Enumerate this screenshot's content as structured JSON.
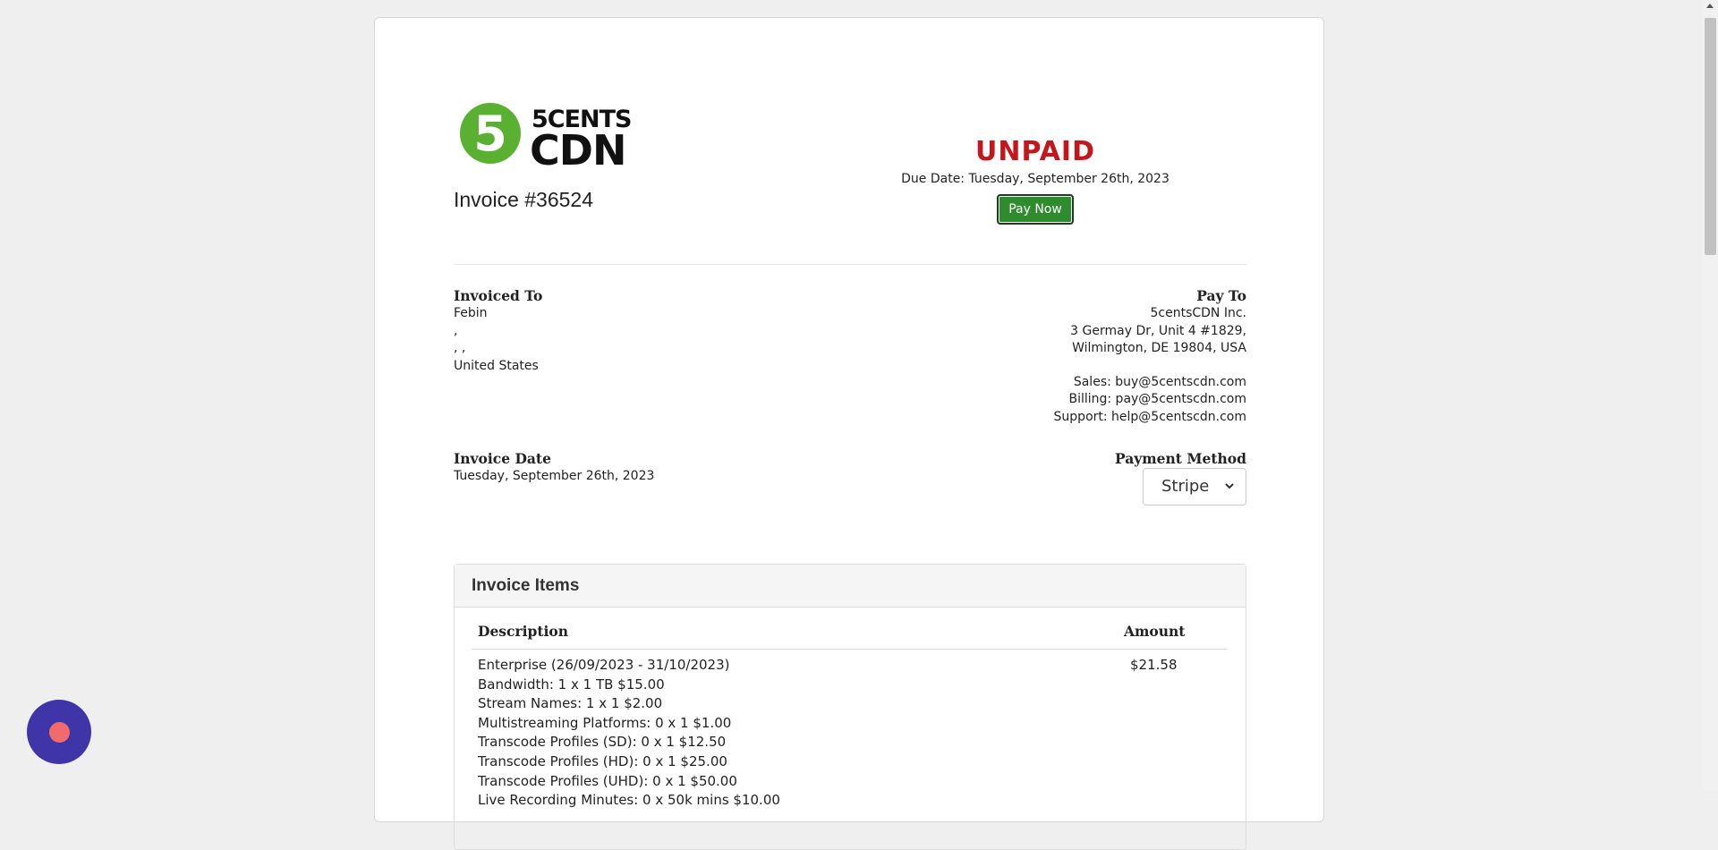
{
  "brand": {
    "logo_numeral": "5",
    "logo_text_top": "5CENTS",
    "logo_text_bottom": "CDN",
    "accent_color": "#5ab030"
  },
  "invoice": {
    "number": "Invoice #36524",
    "status": "UNPAID",
    "status_color": "#c4161c",
    "due_date": "Due Date: Tuesday, September 26th, 2023",
    "pay_now_label": "Pay Now"
  },
  "invoiced_to": {
    "heading": "Invoiced To",
    "lines": [
      "Febin",
      ",",
      ", ,",
      "United States"
    ]
  },
  "pay_to": {
    "heading": "Pay To",
    "lines": [
      "5centsCDN Inc.",
      "3 Germay Dr, Unit 4 #1829,",
      "Wilmington, DE 19804, USA"
    ],
    "contacts": [
      "Sales: buy@5centscdn.com",
      "Billing: pay@5centscdn.com",
      "Support: help@5centscdn.com"
    ]
  },
  "invoice_date": {
    "heading": "Invoice Date",
    "value": "Tuesday, September 26th, 2023"
  },
  "payment_method": {
    "heading": "Payment Method",
    "selected": "Stripe"
  },
  "items": {
    "title": "Invoice Items",
    "columns": [
      "Description",
      "Amount"
    ],
    "rows": [
      {
        "description": [
          "Enterprise (26/09/2023 - 31/10/2023)",
          "Bandwidth: 1 x 1 TB $15.00",
          "Stream Names: 1 x 1 $2.00",
          "Multistreaming Platforms: 0 x 1 $1.00",
          "Transcode Profiles (SD): 0 x 1 $12.50",
          "Transcode Profiles (HD): 0 x 1 $25.00",
          "Transcode Profiles (UHD): 0 x 1 $50.00",
          "Live Recording Minutes: 0 x 50k mins $10.00"
        ],
        "amount": "$21.58"
      }
    ]
  }
}
